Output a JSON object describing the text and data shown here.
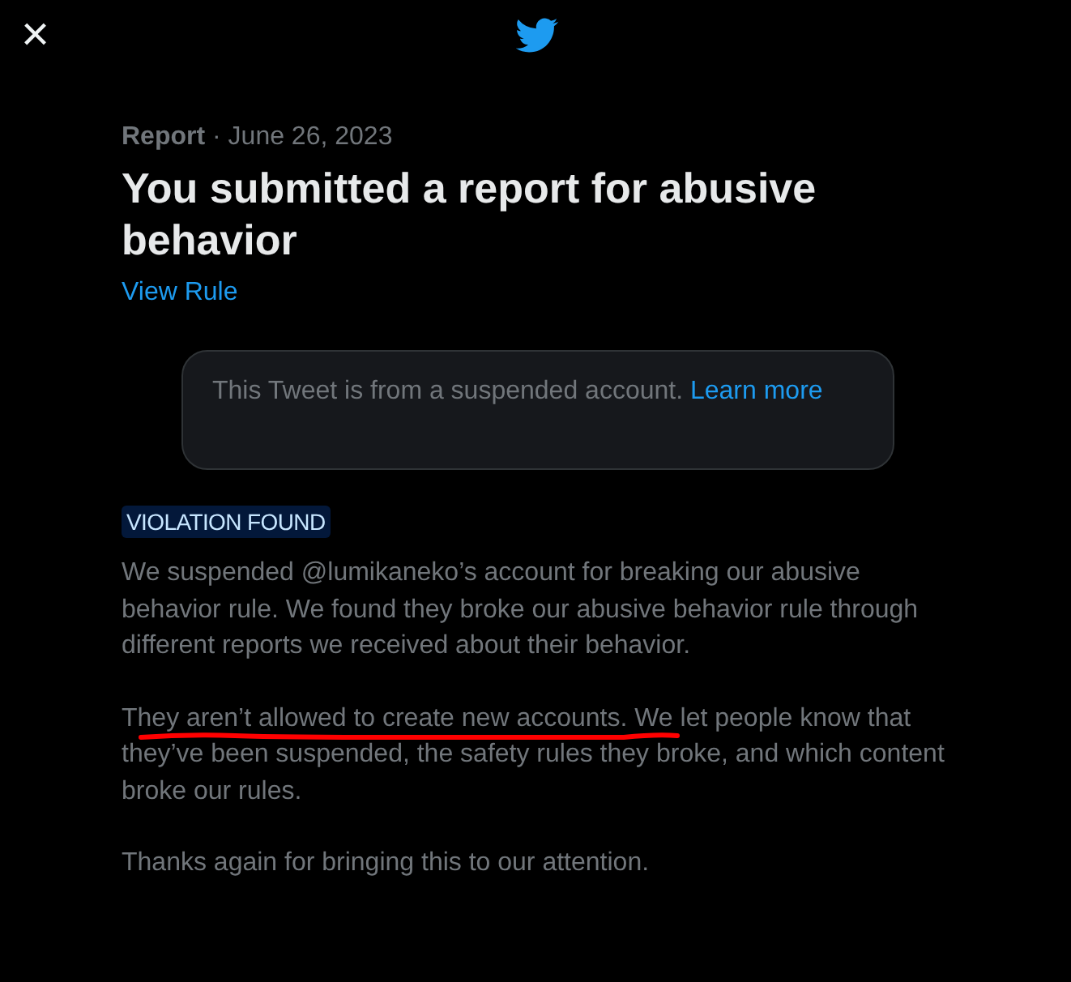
{
  "header": {
    "close": "×"
  },
  "report": {
    "label": "Report",
    "date": "· June 26, 2023",
    "title": "You submitted a report for abusive behavior",
    "rule_link": "View Rule"
  },
  "notice": {
    "text": "This Tweet is from a suspended account.",
    "link": "Learn more"
  },
  "badge": "VIOLATION FOUND",
  "paragraphs": [
    {
      "text": "We suspended @lumikaneko’s account for breaking our abusive behavior rule. We found they broke our abusive behavior rule through different reports we received about their behavior.",
      "underlined": false
    },
    {
      "text": "They aren’t allowed to create new accounts. We let people know that they’ve been suspended, the safety rules they broke, and which content broke our rules.",
      "underlined": true
    },
    {
      "text": "Thanks again for bringing this to our attention.",
      "underlined": false
    }
  ]
}
